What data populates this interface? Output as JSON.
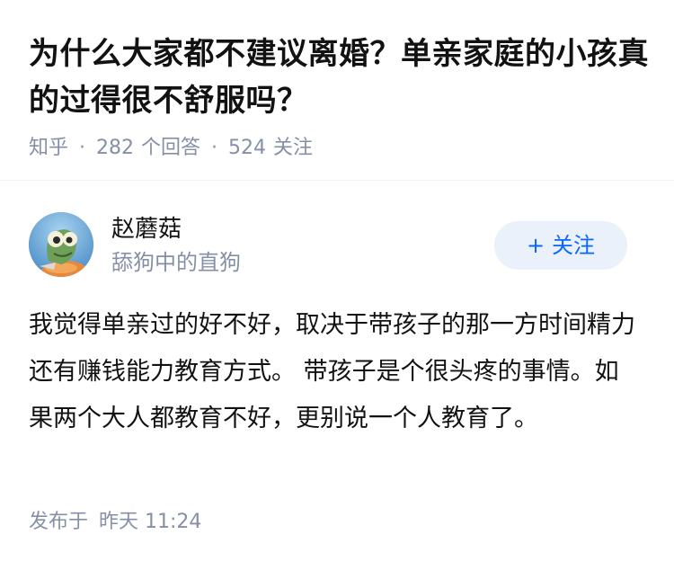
{
  "question": {
    "title": "为什么大家都不建议离婚？单亲家庭的小孩真的过得很不舒服吗？",
    "source": "知乎",
    "answer_count": "282",
    "answer_count_label": "个回答",
    "follower_count": "524",
    "follower_count_label": "关注"
  },
  "author": {
    "avatar_icon": "cartoon-chameleon-avatar-icon",
    "name": "赵蘑菇",
    "bio": "舔狗中的直狗",
    "follow_plus": "+",
    "follow_label": "关注"
  },
  "answer": {
    "content": "我觉得单亲过的好不好，取决于带孩子的那一方时间精力还有赚钱能力教育方式。 带孩子是个很头疼的事情。如果两个大人都教育不好，更别说一个人教育了。",
    "publish_label": "发布于",
    "publish_time": "昨天 11:24"
  },
  "colors": {
    "title": "#121212",
    "meta": "#8590a6",
    "follow_text": "#0a66ff",
    "follow_bg": "#eaf1fb"
  }
}
